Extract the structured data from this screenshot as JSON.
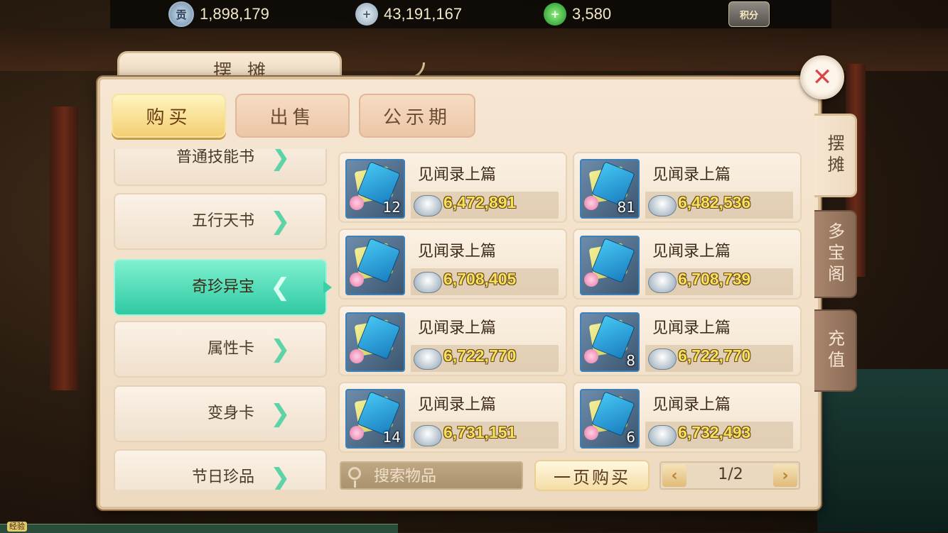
{
  "topbar": {
    "contribution": {
      "icon": "gong-coin-icon",
      "glyph": "贡",
      "value": "1,898,179"
    },
    "silver": {
      "icon": "silver-ingot-icon",
      "glyph": "",
      "value": "43,191,167"
    },
    "jade": {
      "icon": "jade-icon",
      "glyph": "",
      "value": "3,580"
    },
    "score": {
      "icon": "score-badge-icon",
      "label": "积分"
    }
  },
  "window": {
    "title": "摆摊",
    "close_icon": "close-icon"
  },
  "tabs": [
    {
      "label": "购买",
      "active": true
    },
    {
      "label": "出售",
      "active": false
    },
    {
      "label": "公示期",
      "active": false
    }
  ],
  "categories": [
    {
      "label": "普通技能书",
      "active": false
    },
    {
      "label": "五行天书",
      "active": false
    },
    {
      "label": "奇珍异宝",
      "active": true
    },
    {
      "label": "属性卡",
      "active": false
    },
    {
      "label": "变身卡",
      "active": false
    },
    {
      "label": "节日珍品",
      "active": false
    }
  ],
  "items": [
    {
      "name": "见闻录上篇",
      "count": "12",
      "price": "6,472,891"
    },
    {
      "name": "见闻录上篇",
      "count": "81",
      "price": "6,482,536"
    },
    {
      "name": "见闻录上篇",
      "count": "",
      "price": "6,708,405"
    },
    {
      "name": "见闻录上篇",
      "count": "",
      "price": "6,708,739"
    },
    {
      "name": "见闻录上篇",
      "count": "",
      "price": "6,722,770"
    },
    {
      "name": "见闻录上篇",
      "count": "8",
      "price": "6,722,770"
    },
    {
      "name": "见闻录上篇",
      "count": "14",
      "price": "6,731,151"
    },
    {
      "name": "见闻录上篇",
      "count": "6",
      "price": "6,732,493"
    }
  ],
  "search": {
    "placeholder": "搜索物品",
    "value": ""
  },
  "buy_page_button": "一页购买",
  "pager": {
    "prev": "‹",
    "next": "›",
    "page": "1/2"
  },
  "side_tabs": [
    {
      "label": "摆摊",
      "active": true
    },
    {
      "label": "多宝阁",
      "active": false
    },
    {
      "label": "充值",
      "active": false
    }
  ],
  "exp_label": "经验",
  "colors": {
    "accent_green": "#2fcaa3",
    "price_yellow": "#f7e25a",
    "close_red": "#d8464c"
  }
}
